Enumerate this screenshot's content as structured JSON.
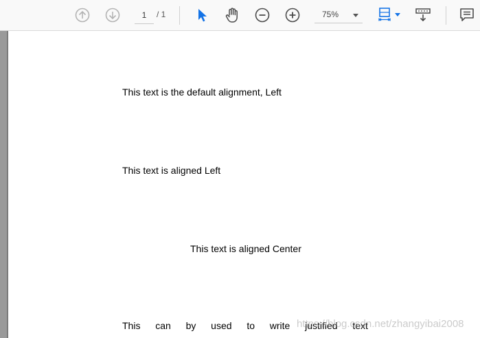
{
  "toolbar": {
    "prev_page_icon": "arrow-up-circle-icon",
    "next_page_icon": "arrow-down-circle-icon",
    "current_page": "1",
    "total_pages": "/ 1",
    "select_tool_icon": "pointer-arrow-icon",
    "hand_tool_icon": "hand-icon",
    "zoom_out_icon": "minus-circle-icon",
    "zoom_in_icon": "plus-circle-icon",
    "zoom_level": "75%",
    "fit_page_icon": "fit-page-icon",
    "scroll_mode_icon": "scroll-mode-icon",
    "comment_icon": "comment-icon"
  },
  "document": {
    "line1": "This text is the default alignment, Left",
    "line2": "This text is aligned Left",
    "line3": "This text is aligned Center",
    "justified_words": [
      "This",
      "can",
      "by",
      "used",
      "to",
      "write",
      "justified",
      "text"
    ]
  },
  "watermark": "https://blog.csdn.net/zhangyibai2008",
  "colors": {
    "accent": "#1473e6",
    "toolbar_bg": "#f9f9f9",
    "disabled_icon": "#b3b3b3",
    "icon": "#4b4b4b"
  }
}
